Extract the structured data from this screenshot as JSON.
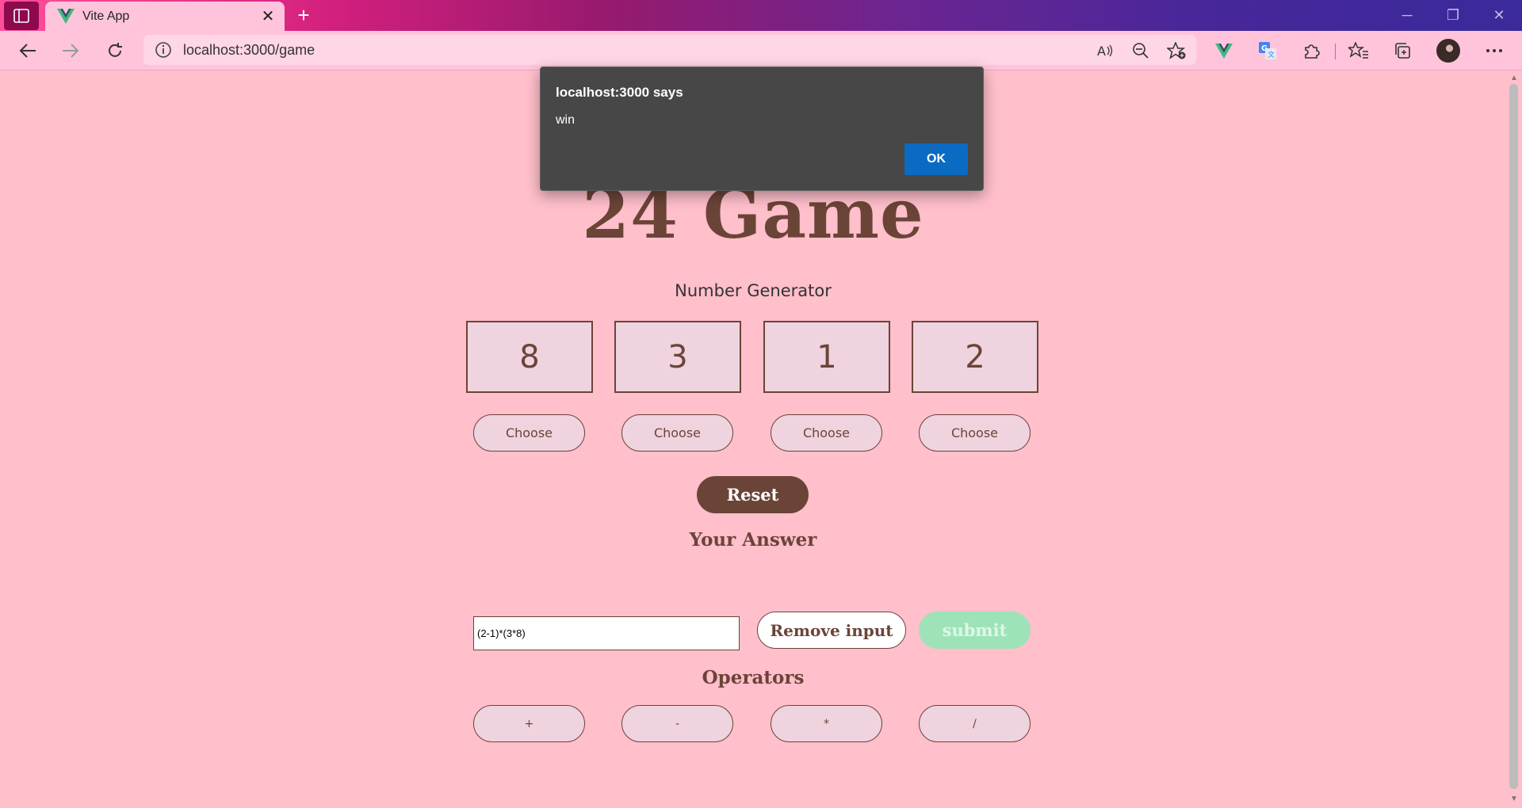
{
  "browser": {
    "tab_title": "Vite App",
    "tab_close": "✕",
    "new_tab": "+",
    "url": "localhost:3000/game",
    "icons": [
      "sidebar-icon",
      "vue-favicon",
      "back-icon",
      "forward-icon",
      "refresh-icon",
      "info-icon",
      "read-aloud-icon",
      "zoom-out-icon",
      "add-favorite-icon",
      "vue-extension-icon",
      "translate-icon",
      "extensions-icon",
      "favorites-icon",
      "collections-icon",
      "profile-avatar",
      "more-icon",
      "minimize-icon",
      "restore-icon",
      "close-window-icon"
    ]
  },
  "game": {
    "title": "24 Game",
    "subtitle": "Number Generator",
    "numbers": [
      "8",
      "3",
      "1",
      "2"
    ],
    "choose_label": "Choose",
    "reset_label": "Reset",
    "answer_label": "Your Answer",
    "answer_value": "(2-1)*(3*8)",
    "remove_label": "Remove input",
    "submit_label": "submit",
    "operators_label": "Operators",
    "operators": [
      "+",
      "-",
      "*",
      "/"
    ]
  },
  "dialog": {
    "title": "localhost:3000 says",
    "message": "win",
    "ok_label": "OK"
  },
  "colors": {
    "page_bg": "#ffbfcb",
    "primary_brown": "#6b4438",
    "tile_bg": "#efd3de",
    "submit_green": "#9ee3b8",
    "dialog_bg": "#474747",
    "ok_blue": "#0b6ac2"
  }
}
